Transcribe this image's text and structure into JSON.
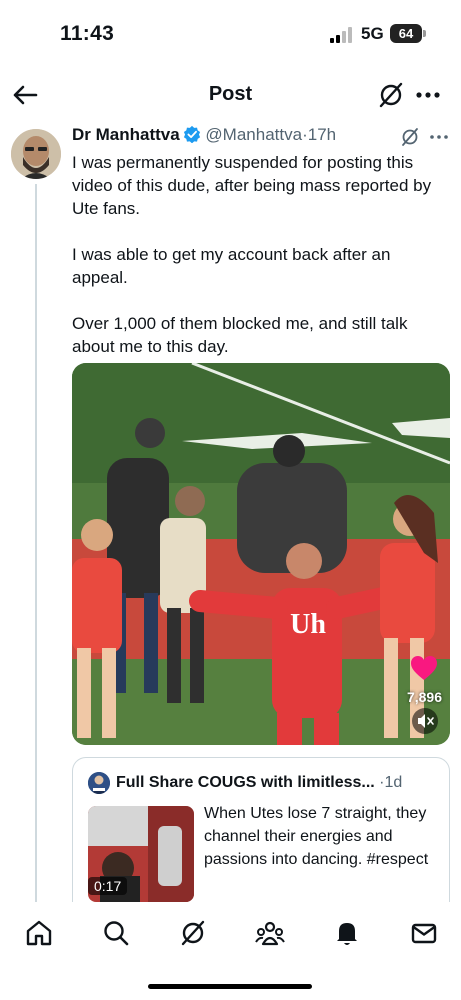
{
  "status_bar": {
    "time": "11:43",
    "network": "5G",
    "battery": "64"
  },
  "nav": {
    "title": "Post",
    "back_icon": "arrow-left-icon",
    "grok_icon": "grok-icon",
    "more_icon": "more-horizontal-icon"
  },
  "tweet": {
    "author_name": "Dr Manhattva",
    "handle": "@Manhattva",
    "separator": "·",
    "time": "17h",
    "paragraphs": [
      "I was permanently suspended for posting this video of this dude, after being mass reported by Ute fans.",
      "I was able to get my account back after an appeal.",
      "Over 1,000 of them blocked me, and still talk about me to this day."
    ],
    "media": {
      "like_count": "7,896",
      "jersey_text": "Uh"
    },
    "quote": {
      "author_name": "Full Share COUGS with limitless...",
      "separator": "·",
      "time": "1d",
      "duration": "0:17",
      "text": "When Utes lose 7 straight, they channel their energies and passions into dancing. #respect"
    }
  },
  "tab_bar": {
    "items": [
      "home-icon",
      "search-icon",
      "grok-icon",
      "communities-icon",
      "notifications-icon",
      "messages-icon"
    ]
  },
  "colors": {
    "accent": "#1d9bf0",
    "text": "#0f1419",
    "secondary_text": "#536471",
    "border": "#cfd9de",
    "like": "#f91880"
  }
}
